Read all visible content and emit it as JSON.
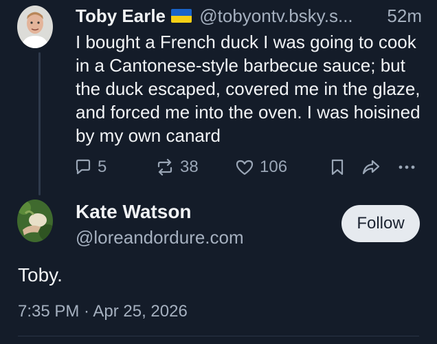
{
  "reply": {
    "author_name": "Toby Earle",
    "flag_emoji": "🇺🇦",
    "handle": "@tobyontv.bsky.s...",
    "time_ago": "52m",
    "text": "I bought a French duck I was going to cook in a Cantonese-style barbecue sauce; but the duck escaped, covered me in the glaze, and forced me into the oven. I was hoisined by my own canard",
    "counts": {
      "replies": "5",
      "reposts": "38",
      "likes": "106"
    }
  },
  "post": {
    "author_name": "Kate Watson",
    "handle": "@loreandordure.com",
    "follow_label": "Follow",
    "text": "Toby.",
    "timestamp": "7:35 PM · Apr 25, 2026"
  },
  "icons": [
    "reply-icon",
    "repost-icon",
    "like-icon",
    "bookmark-icon",
    "share-icon",
    "more-icon"
  ],
  "colors": {
    "background": "#141c29",
    "text": "#f1f3f5",
    "muted": "#a5b0bf",
    "icon": "#9aa6b6",
    "follow_bg": "#e6eaef"
  }
}
